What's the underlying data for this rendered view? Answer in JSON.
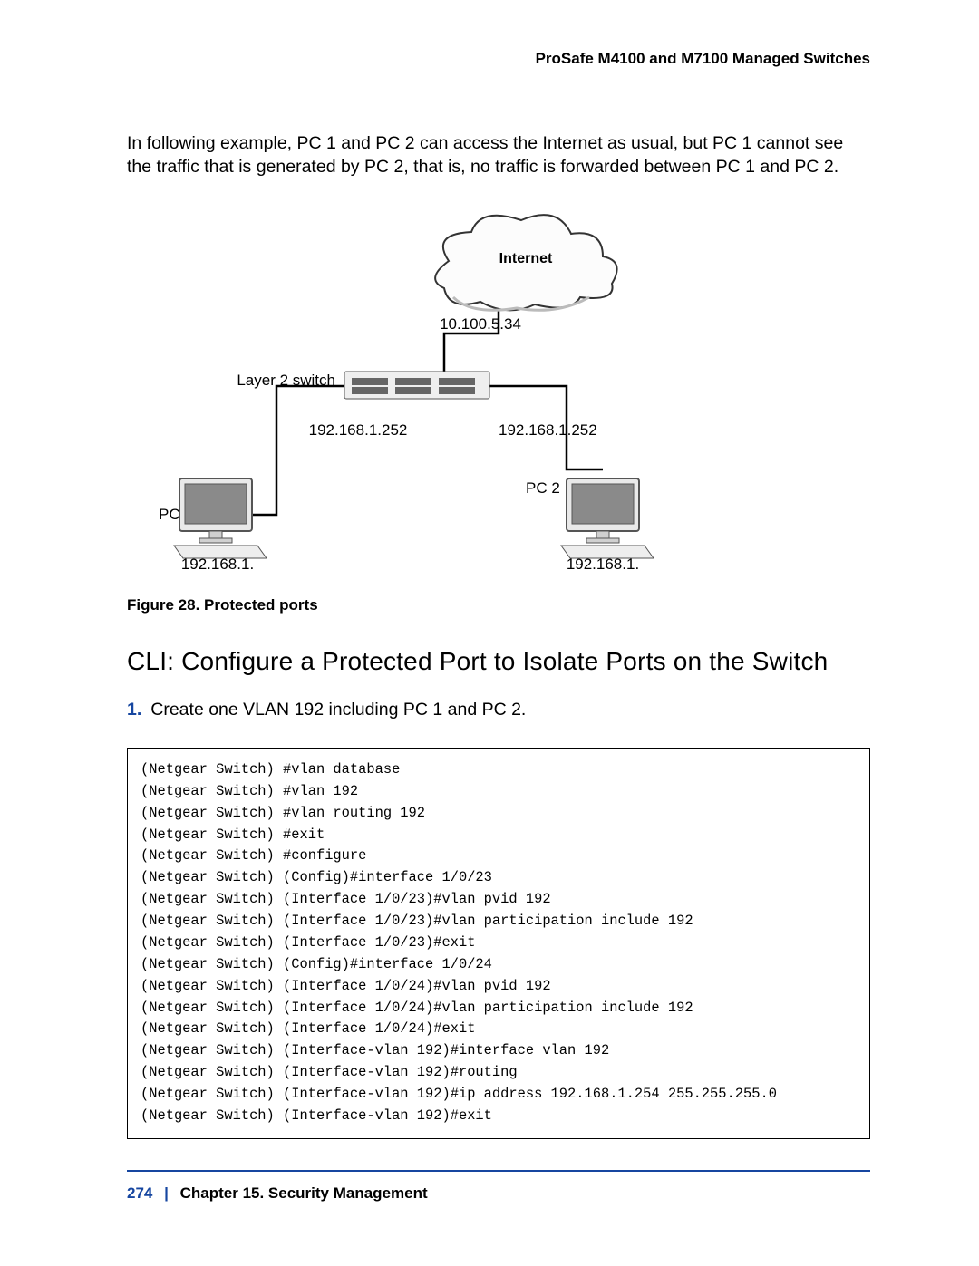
{
  "header": {
    "running_head": "ProSafe M4100 and M7100 Managed Switches"
  },
  "intro_paragraph": "In following example, PC 1 and PC 2 can access the Internet as usual, but PC 1 cannot see the traffic that is generated by PC 2, that is, no traffic is forwarded between PC 1 and PC 2.",
  "diagram": {
    "internet_label": "Internet",
    "switch_label": "Layer 2 switch",
    "uplink_ip": "10.100.5.34",
    "left_ip": "192.168.1.252",
    "right_ip": "192.168.1.252",
    "pc1_label": "PC 1",
    "pc1_ip": "192.168.1.",
    "pc2_label": "PC 2",
    "pc2_ip": "192.168.1."
  },
  "figure_caption": "Figure 28. Protected ports",
  "section_heading": "CLI: Configure a Protected Port to Isolate Ports on the Switch",
  "step": {
    "number": "1.",
    "text": "Create one VLAN 192 including PC 1 and PC 2."
  },
  "cli_block": "(Netgear Switch) #vlan database\n(Netgear Switch) #vlan 192\n(Netgear Switch) #vlan routing 192\n(Netgear Switch) #exit\n(Netgear Switch) #configure\n(Netgear Switch) (Config)#interface 1/0/23\n(Netgear Switch) (Interface 1/0/23)#vlan pvid 192\n(Netgear Switch) (Interface 1/0/23)#vlan participation include 192\n(Netgear Switch) (Interface 1/0/23)#exit\n(Netgear Switch) (Config)#interface 1/0/24\n(Netgear Switch) (Interface 1/0/24)#vlan pvid 192\n(Netgear Switch) (Interface 1/0/24)#vlan participation include 192\n(Netgear Switch) (Interface 1/0/24)#exit\n(Netgear Switch) (Interface-vlan 192)#interface vlan 192\n(Netgear Switch) (Interface-vlan 192)#routing\n(Netgear Switch) (Interface-vlan 192)#ip address 192.168.1.254 255.255.255.0\n(Netgear Switch) (Interface-vlan 192)#exit",
  "footer": {
    "page_number": "274",
    "separator": "|",
    "chapter": "Chapter 15.  Security Management"
  }
}
